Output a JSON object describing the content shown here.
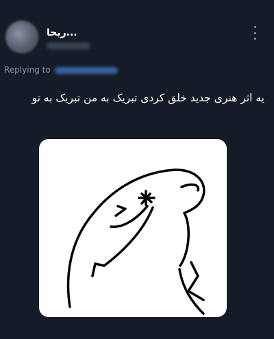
{
  "tweet": {
    "author_name": "ریحا...",
    "replying_label": "Replying to",
    "text": "یه اثر هنری جدید خلق کردی تبریک به من تبریک به تو"
  },
  "colors": {
    "background": "#161c27",
    "text": "#ffffff",
    "muted": "#8b98a5",
    "link": "#3a6fb8"
  },
  "icons": [
    "more-options-icon"
  ]
}
